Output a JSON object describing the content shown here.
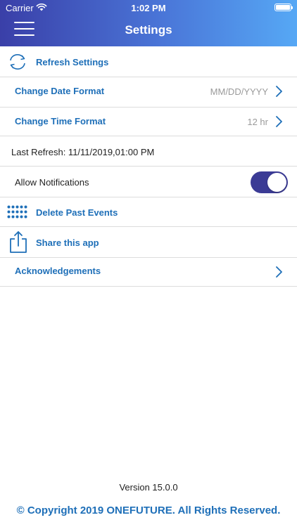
{
  "status_bar": {
    "carrier": "Carrier",
    "time": "1:02 PM"
  },
  "header": {
    "title": "Settings"
  },
  "rows": {
    "refresh_settings": {
      "label": "Refresh Settings",
      "icon": "refresh-icon"
    },
    "date_format": {
      "label": "Change Date Format",
      "value": "MM/DD/YYYY",
      "icon": "chevron-right-icon"
    },
    "time_format": {
      "label": "Change Time Format",
      "value": "12 hr",
      "icon": "chevron-right-icon"
    },
    "last_refresh": {
      "label": "Last Refresh: 11/11/2019,01:00 PM"
    },
    "notifications": {
      "label": "Allow Notifications",
      "enabled": true
    },
    "delete_events": {
      "label": "Delete Past Events",
      "icon": "dot-grid-icon"
    },
    "share_app": {
      "label": "Share this app",
      "icon": "share-icon"
    },
    "acknowledgements": {
      "label": "Acknowledgements",
      "icon": "chevron-right-icon"
    }
  },
  "footer": {
    "version": "Version 15.0.0",
    "copyright": "© Copyright 2019 ONEFUTURE. All Rights Reserved."
  },
  "colors": {
    "accent_blue": "#1e6fb8",
    "toggle_on": "#3b3b95",
    "header_gradient_start": "#3a3fa8",
    "header_gradient_end": "#56a8f5"
  }
}
